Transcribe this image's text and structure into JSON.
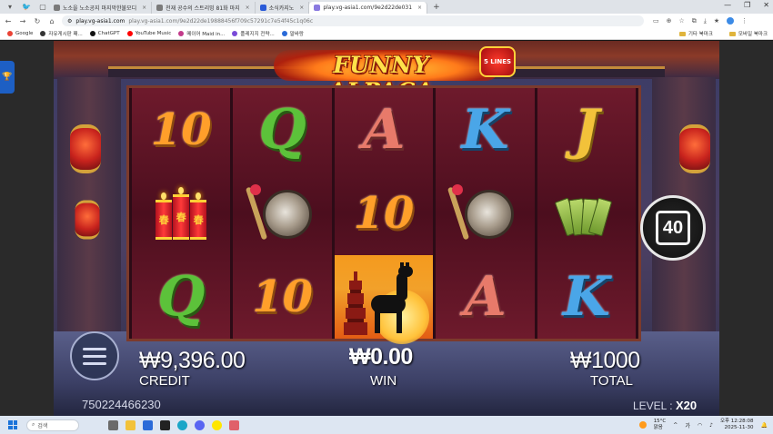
{
  "browser": {
    "tabs": [
      {
        "title": "노소을 노소공지 마지막한불모디",
        "active": false
      },
      {
        "title": "천재 공수의 스트리밍 81화 마지",
        "active": false
      },
      {
        "title": "소식카지노",
        "active": false
      },
      {
        "title": "play.vg-asia1.com/9e2d22de031",
        "active": true
      }
    ],
    "new_tab": "+",
    "url_host": "play.vg-asia1.com",
    "url_path": "play.vg-asia1.com/9e2d22de19888456f709c57291c7e54f45c1q06c",
    "bookmarks": [
      {
        "label": "Google",
        "color": "#ea4335"
      },
      {
        "label": "자유게시판 패...",
        "color": "#333333"
      },
      {
        "label": "ChatGPT",
        "color": "#111111"
      },
      {
        "label": "YouTube Music",
        "color": "#ff0000"
      },
      {
        "label": "메이어 Maid in...",
        "color": "#c23a8a"
      },
      {
        "label": "플레지지 전략...",
        "color": "#7a4ad8"
      },
      {
        "label": "말바랑",
        "color": "#2a6ad8"
      }
    ],
    "bookmark_folders": [
      "기타 북마크",
      "모바일 북마크"
    ]
  },
  "game": {
    "logo_text": "FUNNY ALPACA",
    "logo_badge": "5 LINES",
    "reels": [
      [
        "10",
        "firecracker",
        "Q"
      ],
      [
        "Q",
        "gong",
        "10"
      ],
      [
        "A",
        "10",
        "alpaca"
      ],
      [
        "K",
        "gong",
        "A"
      ],
      [
        "J",
        "fan",
        "K"
      ]
    ],
    "credit_amount": "₩9,396.00",
    "credit_label": "CREDIT",
    "win_amount": "₩0.00",
    "win_label": "WIN",
    "total_amount": "₩1000",
    "total_label": "TOTAL",
    "session_id": "750224466230",
    "level_label": "LEVEL :",
    "level_value": "X20",
    "spin_value": "40",
    "colors": {
      "credit_text": "#ffffff",
      "frame": "#7c3a2c",
      "reel_bg": "#6e1a2c"
    }
  },
  "taskbar": {
    "search_placeholder": "검색",
    "weather_temp": "15°C",
    "weather_desc": "맑음",
    "ime": "가",
    "time": "오후 12:28:08",
    "date": "2025-11-30"
  }
}
